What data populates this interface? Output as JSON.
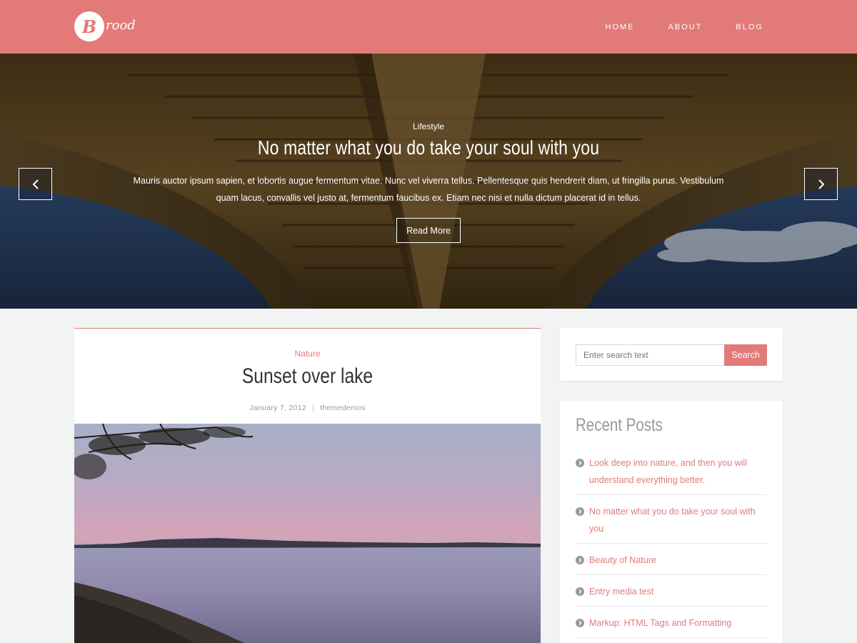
{
  "site": {
    "logo_letter": "B",
    "logo_text": "rood"
  },
  "nav": {
    "items": [
      "HOME",
      "ABOUT",
      "BLOG"
    ]
  },
  "hero": {
    "category": "Lifestyle",
    "title": "No matter what you do take your soul with you",
    "excerpt": "Mauris auctor ipsum sapien, et lobortis augue fermentum vitae. Nunc vel viverra tellus. Pellentesque quis hendrerit diam, ut fringilla purus. Vestibulum quam lacus, convallis vel justo at, fermentum faucibus ex. Etiam nec nisi et nulla dictum placerat id in tellus.",
    "button_label": "Read More",
    "prev_icon": "chevron-left-icon",
    "next_icon": "chevron-right-icon"
  },
  "post": {
    "category": "Nature",
    "title": "Sunset over lake",
    "date": "January 7, 2012",
    "separator": "|",
    "author": "themedemos"
  },
  "search": {
    "placeholder": "Enter search text",
    "button_label": "Search"
  },
  "recent_posts": {
    "title": "Recent Posts",
    "items": [
      "Look deep into nature, and then you will understand everything better.",
      "No matter what you do take your soul with you",
      "Beauty of Nature",
      "Entry media test",
      "Markup: HTML Tags and Formatting"
    ]
  },
  "colors": {
    "accent": "#e27a78",
    "background": "#f2f4f3"
  }
}
